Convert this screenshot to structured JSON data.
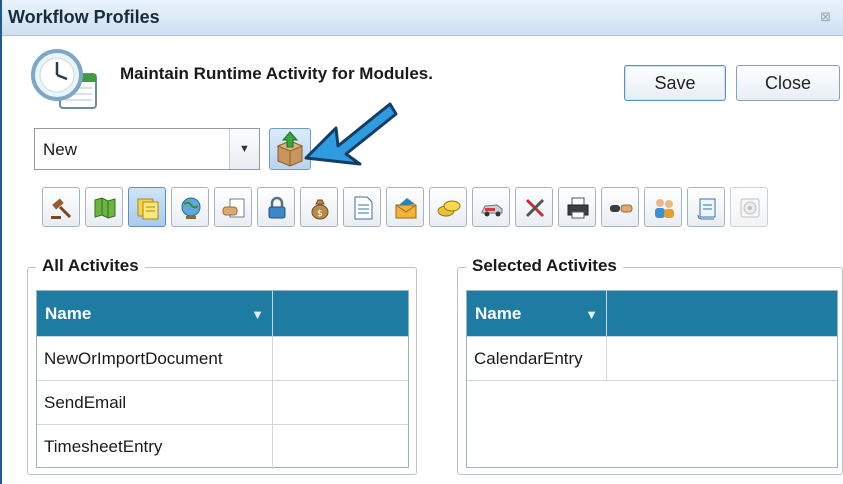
{
  "window": {
    "title": "Workflow Profiles",
    "close_glyph": "⊠"
  },
  "header": {
    "icon": "calendar-clock-icon",
    "heading": "Maintain Runtime Activity for Modules."
  },
  "actions": {
    "save_label": "Save",
    "close_label": "Close"
  },
  "profile": {
    "selected": "New",
    "import_icon": "package-upload-icon",
    "callout": "arrow-pointing-left"
  },
  "toolbar": {
    "active_index": 2,
    "icons": [
      "gavel-icon",
      "map-icon",
      "sticky-notes-icon",
      "globe-icon",
      "handshake-document-icon",
      "lock-icon",
      "money-bag-icon",
      "document-icon",
      "envelope-icon",
      "coins-icon",
      "car-icon",
      "tools-icon",
      "printer-icon",
      "handshake-icon",
      "people-icon",
      "scroll-icon",
      "disc-icon"
    ]
  },
  "all_activities": {
    "label": "All Activites",
    "column": "Name",
    "rows": [
      "NewOrImportDocument",
      "SendEmail",
      "TimesheetEntry"
    ]
  },
  "selected_activities": {
    "label": "Selected Activites",
    "column": "Name",
    "rows": [
      "CalendarEntry"
    ]
  },
  "colors": {
    "grid_header": "#1e7ca3",
    "accent_arrow": "#2f9be0",
    "title_bar": "#cfe1f3"
  }
}
